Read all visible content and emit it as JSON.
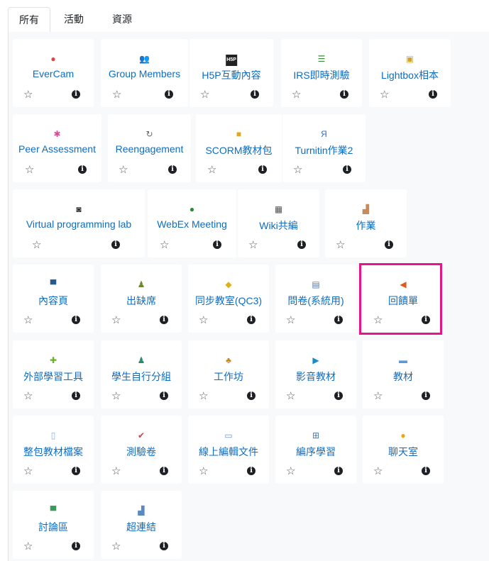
{
  "tabs": [
    "所有",
    "活動",
    "資源"
  ],
  "info_glyph": "i",
  "star_glyph": "☆",
  "modules": [
    {
      "label": "EverCam",
      "icon": "evercam-icon",
      "glyph": "●",
      "color": "#e04646"
    },
    {
      "label": "Group Members",
      "icon": "group-members-icon",
      "glyph": "👥",
      "color": "#d9851a"
    },
    {
      "label": "H5P互動內容",
      "icon": "h5p-icon",
      "glyph": "H5P",
      "color": "#222222"
    },
    {
      "label": "IRS即時測驗",
      "icon": "irs-list-icon",
      "glyph": "☰",
      "color": "#3a8a3a"
    },
    {
      "label": "Lightbox相本",
      "icon": "lightbox-gallery-icon",
      "glyph": "▣",
      "color": "#d9a21a"
    },
    {
      "label": "Peer Assessment",
      "icon": "peer-assessment-icon",
      "glyph": "✱",
      "color": "#d94a9a"
    },
    {
      "label": "Reengagement",
      "icon": "reengagement-icon",
      "glyph": "↻",
      "color": "#666666"
    },
    {
      "label": "SCORM教材包",
      "icon": "scorm-package-icon",
      "glyph": "■",
      "color": "#e0a81a"
    },
    {
      "label": "Turnitin作業2",
      "icon": "turnitin-icon",
      "glyph": "Я",
      "color": "#2a6fd1"
    },
    {
      "label": "Virtual programming lab",
      "icon": "vpl-icon",
      "glyph": "◙",
      "color": "#333333"
    },
    {
      "label": "WebEx Meeting",
      "icon": "webex-globe-icon",
      "glyph": "●",
      "color": "#2a8a3a"
    },
    {
      "label": "Wiki共編",
      "icon": "wiki-icon",
      "glyph": "▦",
      "color": "#555555"
    },
    {
      "label": "作業",
      "icon": "assignment-icon",
      "glyph": "▟",
      "color": "#c98a5a"
    },
    {
      "label": "內容頁",
      "icon": "page-icon",
      "glyph": "▀",
      "color": "#2a5a8a"
    },
    {
      "label": "出缺席",
      "icon": "attendance-icon",
      "glyph": "♟",
      "color": "#6a8a2a"
    },
    {
      "label": "同步教室(QC3)",
      "icon": "qc3-classroom-icon",
      "glyph": "◆",
      "color": "#e0b01a"
    },
    {
      "label": "問卷(系統用)",
      "icon": "questionnaire-icon",
      "glyph": "▤",
      "color": "#5a7ab0"
    },
    {
      "label": "回饋單",
      "icon": "feedback-megaphone-icon",
      "glyph": "◀",
      "color": "#e05a1a"
    },
    {
      "label": "外部學習工具",
      "icon": "external-tool-puzzle-icon",
      "glyph": "✚",
      "color": "#6ab02a"
    },
    {
      "label": "學生自行分組",
      "icon": "group-choice-icon",
      "glyph": "♟",
      "color": "#2a8a6a"
    },
    {
      "label": "工作坊",
      "icon": "workshop-icon",
      "glyph": "♣",
      "color": "#c9851a"
    },
    {
      "label": "影音教材",
      "icon": "video-play-icon",
      "glyph": "▶",
      "color": "#1a8ad0"
    },
    {
      "label": "教材",
      "icon": "folder-icon",
      "glyph": "▬",
      "color": "#5a9ad8"
    },
    {
      "label": "整包教材檔案",
      "icon": "imscp-file-icon",
      "glyph": "▯",
      "color": "#8ab0e0"
    },
    {
      "label": "測驗卷",
      "icon": "quiz-icon",
      "glyph": "✔",
      "color": "#c04a4a"
    },
    {
      "label": "線上編輯文件",
      "icon": "online-doc-icon",
      "glyph": "▭",
      "color": "#6a9ad0"
    },
    {
      "label": "編序學習",
      "icon": "lesson-icon",
      "glyph": "⊞",
      "color": "#4a7ab0"
    },
    {
      "label": "聊天室",
      "icon": "chat-bubble-icon",
      "glyph": "●",
      "color": "#e0a81a"
    },
    {
      "label": "討論區",
      "icon": "forum-icon",
      "glyph": "▀",
      "color": "#3a9a5a"
    },
    {
      "label": "超連結",
      "icon": "url-link-icon",
      "glyph": "▟",
      "color": "#5a8ac0"
    }
  ]
}
